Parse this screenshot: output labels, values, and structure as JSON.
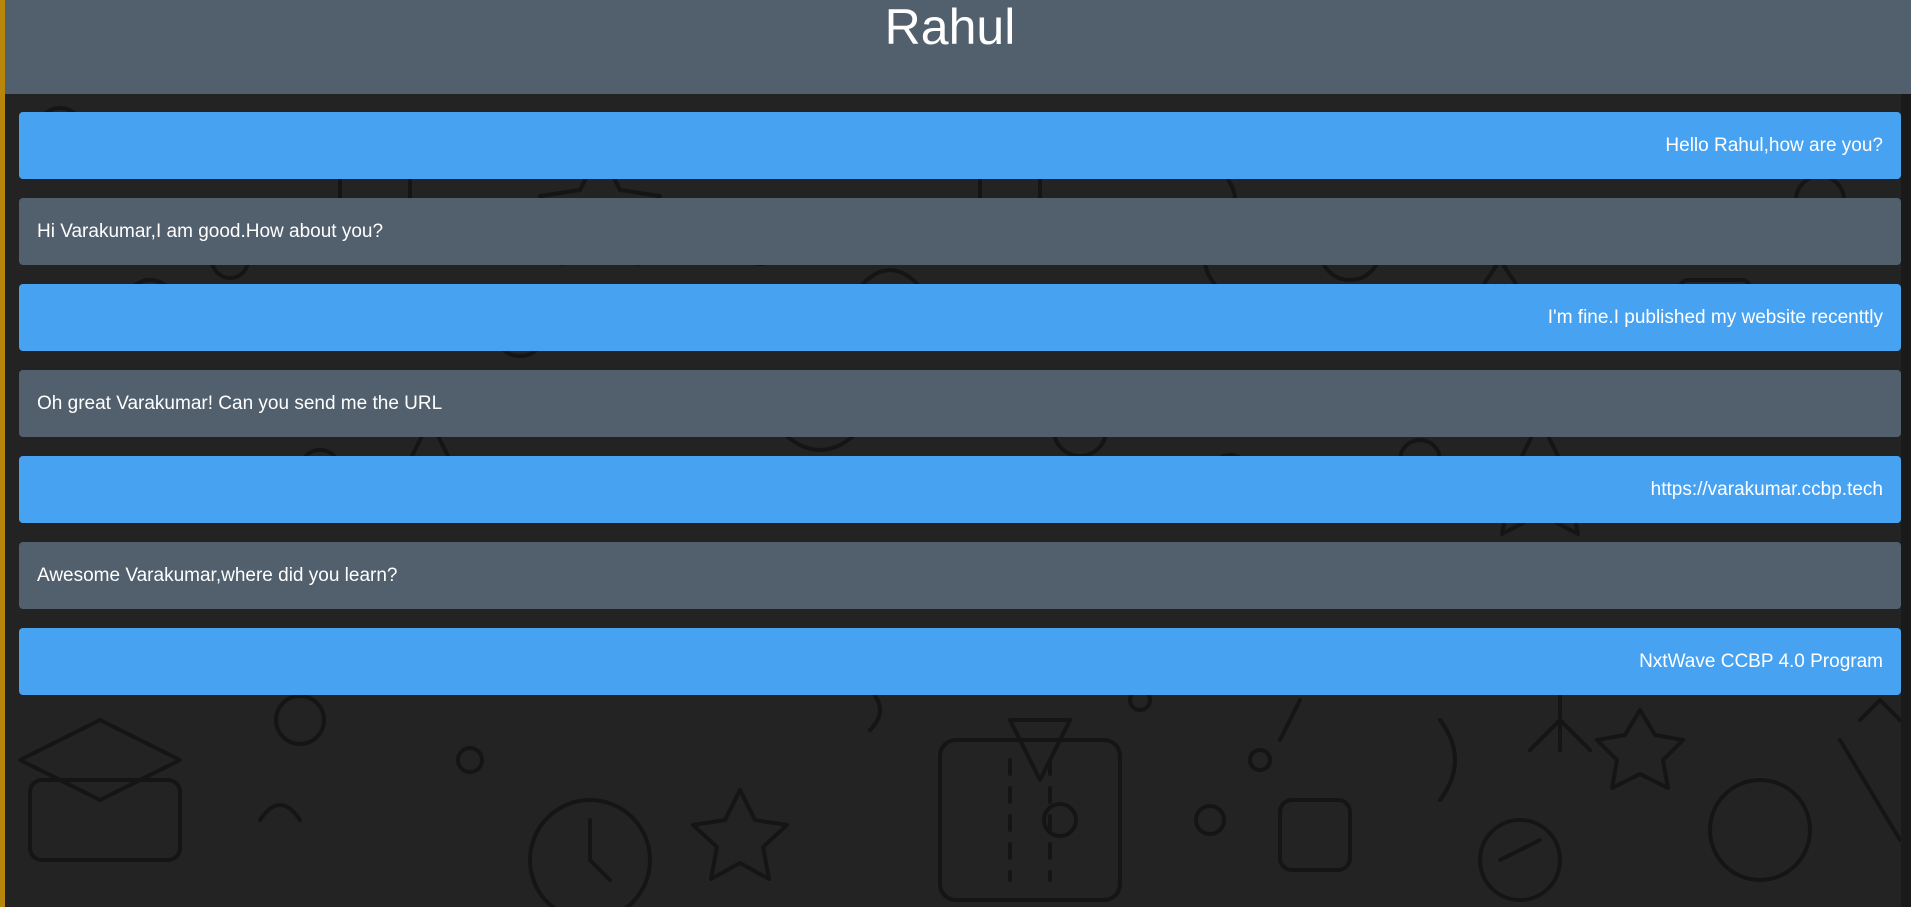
{
  "header": {
    "title": "Rahul"
  },
  "messages": [
    {
      "direction": "sent",
      "text": "Hello Rahul,how are you?"
    },
    {
      "direction": "received",
      "text": "Hi Varakumar,I am good.How about you?"
    },
    {
      "direction": "sent",
      "text": "I'm fine.I published my website recenttly"
    },
    {
      "direction": "received",
      "text": "Oh great Varakumar! Can you send me the URL"
    },
    {
      "direction": "sent",
      "text": "https://varakumar.ccbp.tech"
    },
    {
      "direction": "received",
      "text": "Awesome Varakumar,where did you learn?"
    },
    {
      "direction": "sent",
      "text": "NxtWave CCBP 4.0 Program"
    }
  ],
  "colors": {
    "header_bg": "#525f6d",
    "sent_bubble": "#47a3f2",
    "received_bubble": "#525f6d",
    "background": "#232323",
    "accent_edge": "#b8860b"
  }
}
